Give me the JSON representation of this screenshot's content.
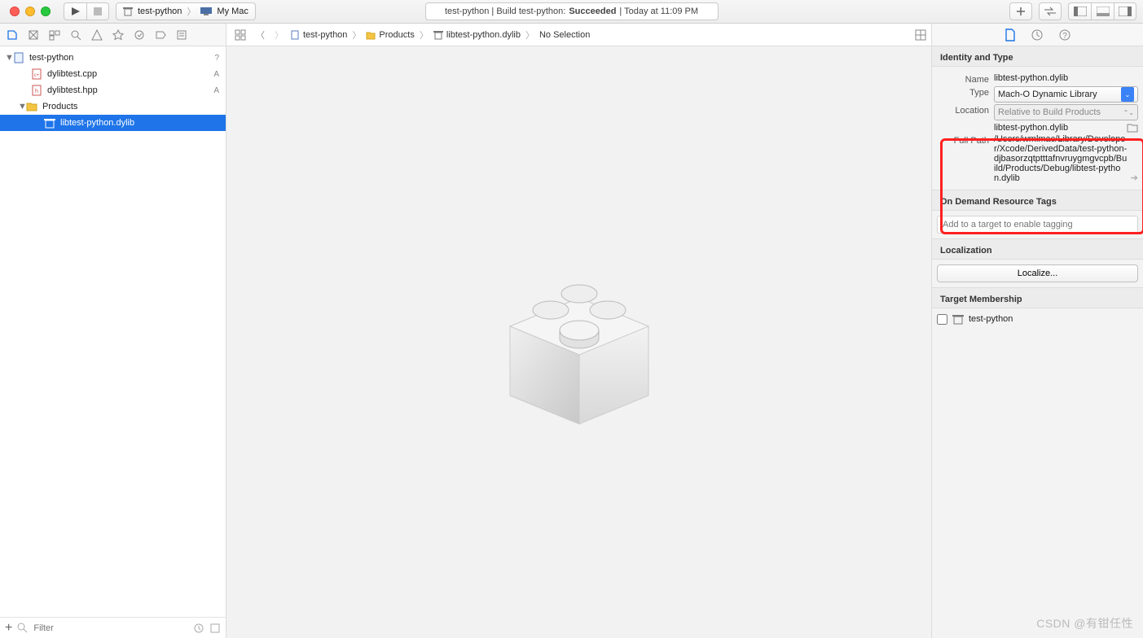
{
  "toolbar": {
    "scheme": {
      "project": "test-python",
      "destination": "My Mac"
    },
    "activity": {
      "prefix": "test-python | Build test-python:",
      "status": "Succeeded",
      "suffix": "| Today at 11:09 PM"
    }
  },
  "navigator": {
    "items": [
      {
        "name": "test-python",
        "kind": "project",
        "badge": "?"
      },
      {
        "name": "dylibtest.cpp",
        "kind": "cpp",
        "badge": "A"
      },
      {
        "name": "dylibtest.hpp",
        "kind": "hpp",
        "badge": "A"
      },
      {
        "name": "Products",
        "kind": "folder"
      },
      {
        "name": "libtest-python.dylib",
        "kind": "dylib"
      }
    ],
    "filter_placeholder": "Filter"
  },
  "breadcrumb": {
    "items": [
      "test-python",
      "Products",
      "libtest-python.dylib",
      "No Selection"
    ]
  },
  "inspector": {
    "identity_header": "Identity and Type",
    "name_label": "Name",
    "name_value": "libtest-python.dylib",
    "type_label": "Type",
    "type_value": "Mach-O Dynamic Library",
    "location_label": "Location",
    "location_value": "Relative to Build Products",
    "location_file": "libtest-python.dylib",
    "fullpath_label": "Full Path",
    "fullpath_value": "/Users/wmlmac/Library/Developer/Xcode/DerivedData/test-python-djbasorzqtptttafnvruygmgvcpb/Build/Products/Debug/libtest-python.dylib",
    "odr_header": "On Demand Resource Tags",
    "odr_placeholder": "Add to a target to enable tagging",
    "loc_header": "Localization",
    "loc_button": "Localize...",
    "target_header": "Target Membership",
    "target_name": "test-python"
  },
  "watermark": "CSDN @有钳任性"
}
